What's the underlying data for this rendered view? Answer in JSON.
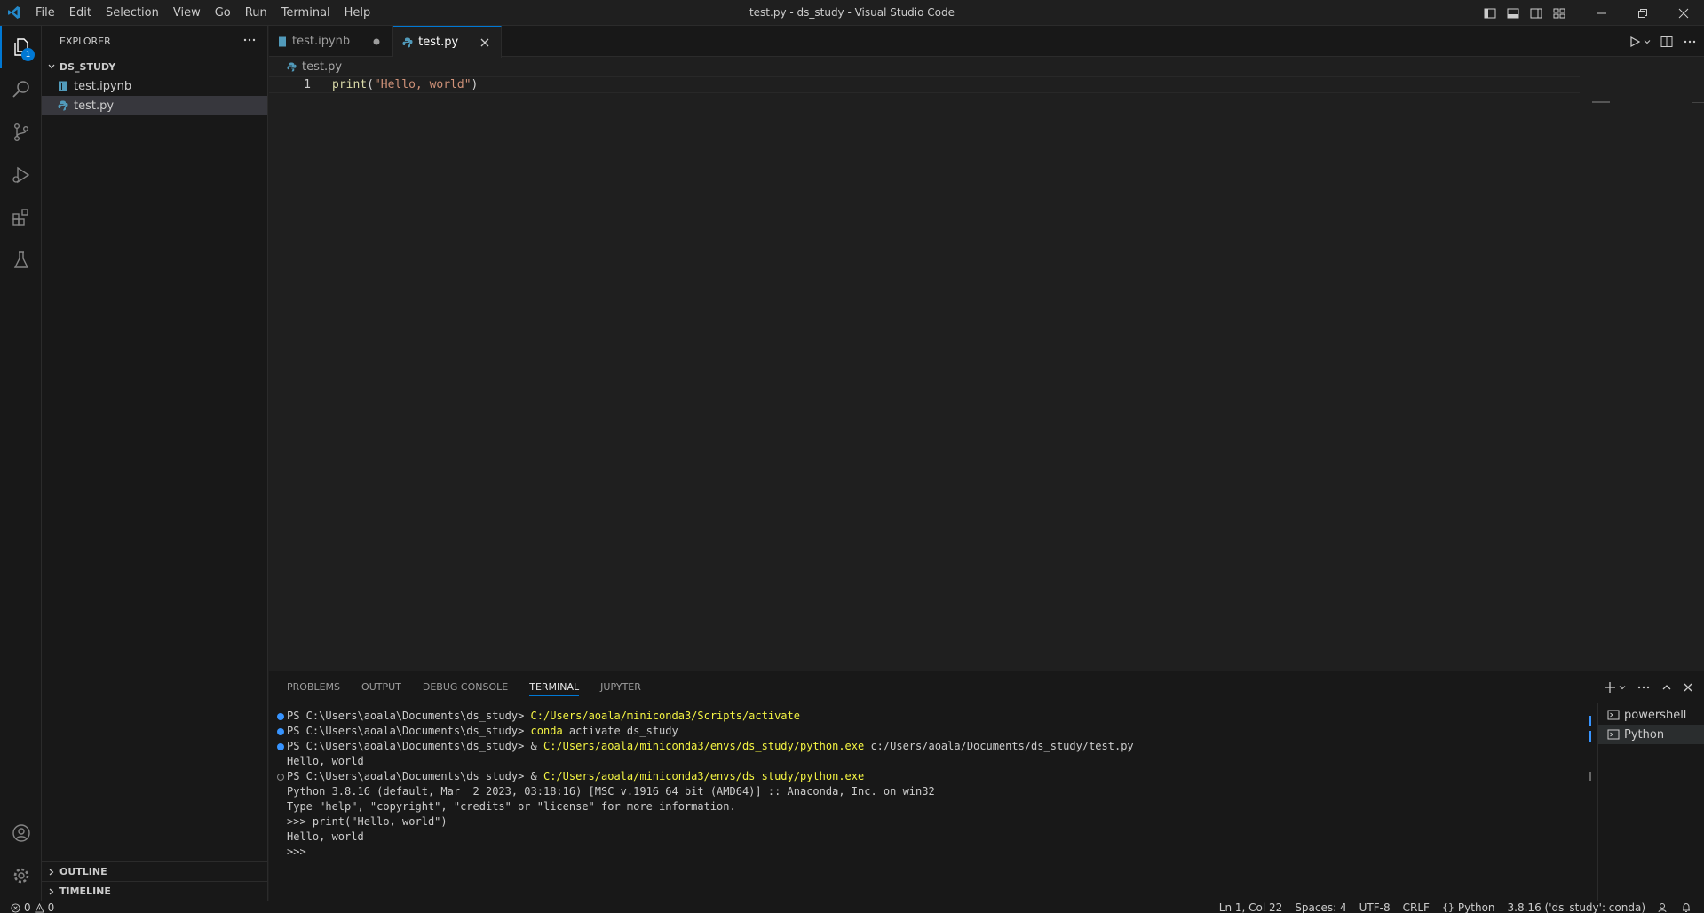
{
  "window": {
    "title": "test.py - ds_study - Visual Studio Code",
    "menu": [
      "File",
      "Edit",
      "Selection",
      "View",
      "Go",
      "Run",
      "Terminal",
      "Help"
    ]
  },
  "activitybar": {
    "explorer_badge": "1",
    "items": [
      "explorer-icon",
      "search-icon",
      "source-control-icon",
      "run-debug-icon",
      "extensions-icon",
      "testing-icon",
      "account-icon",
      "settings-gear-icon"
    ]
  },
  "sidebar": {
    "title": "EXPLORER",
    "folder": "DS_STUDY",
    "files": [
      "test.ipynb",
      "test.py"
    ],
    "outline": "OUTLINE",
    "timeline": "TIMELINE"
  },
  "editor": {
    "tabs": [
      {
        "label": "test.ipynb",
        "dirty": true
      },
      {
        "label": "test.py",
        "active": true
      }
    ],
    "breadcrumb": "test.py",
    "lines": [
      {
        "number": "1",
        "fn": "print",
        "open": "(",
        "str": "\"Hello, world\"",
        "close": ")"
      }
    ]
  },
  "panel": {
    "tabs": [
      "PROBLEMS",
      "OUTPUT",
      "DEBUG CONSOLE",
      "TERMINAL",
      "JUPYTER"
    ],
    "active_tab": "TERMINAL",
    "terminal_lines": {
      "l1_prompt": "PS C:\\Users\\aoala\\Documents\\ds_study> ",
      "l1_cmd": "C:/Users/aoala/miniconda3/Scripts/activate",
      "l2_prompt": "PS C:\\Users\\aoala\\Documents\\ds_study> ",
      "l2_cmd": "conda",
      "l2_rest": " activate ds_study",
      "l3_prompt": "PS C:\\Users\\aoala\\Documents\\ds_study> & ",
      "l3_cmd": "C:/Users/aoala/miniconda3/envs/ds_study/python.exe",
      "l3_rest": " c:/Users/aoala/Documents/ds_study/test.py",
      "l4": "Hello, world",
      "l5_prompt": "PS C:\\Users\\aoala\\Documents\\ds_study> & ",
      "l5_cmd": "C:/Users/aoala/miniconda3/envs/ds_study/python.exe",
      "l6": "Python 3.8.16 (default, Mar  2 2023, 03:18:16) [MSC v.1916 64 bit (AMD64)] :: Anaconda, Inc. on win32",
      "l7": "Type \"help\", \"copyright\", \"credits\" or \"license\" for more information.",
      "l8": ">>> print(\"Hello, world\")",
      "l9": "Hello, world",
      "l10": ">>> "
    },
    "terminals": [
      "powershell",
      "Python"
    ]
  },
  "statusbar": {
    "errors": "0",
    "warnings": "0",
    "position": "Ln 1, Col 22",
    "spaces": "Spaces: 4",
    "encoding": "UTF-8",
    "eol": "CRLF",
    "language": "Python",
    "interpreter": "3.8.16 ('ds_study': conda)"
  },
  "colors": {
    "accent": "#0078d4",
    "background": "#1f1f1f",
    "sidebar": "#181818",
    "terminal_yellow": "#f5f543"
  }
}
